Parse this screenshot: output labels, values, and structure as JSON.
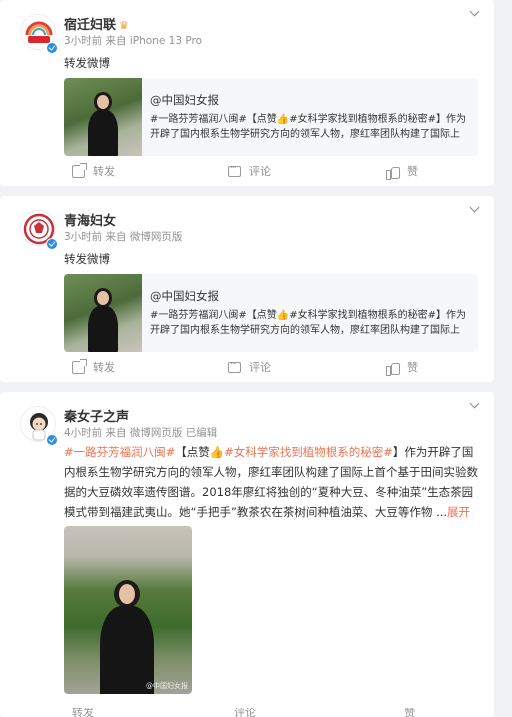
{
  "posts": [
    {
      "user": {
        "name": "宿迁妇联",
        "has_crown": true
      },
      "meta": "3小时前  来自 iPhone 13 Pro",
      "text": "转发微博",
      "quote": {
        "source": "@中国妇女报",
        "text": "#一路芬芳福润八闽#【点赞👍#女科学家找到植物根系的秘密#】作为开辟了国内根系生物学研究方向的领军人物，廖红率团队构建了国际上首…"
      },
      "actions": {
        "share": "转发",
        "comment": "评论",
        "like": "赞"
      }
    },
    {
      "user": {
        "name": "青海妇女",
        "has_crown": false
      },
      "meta": "3小时前  来自 微博网页版",
      "text": "转发微博",
      "quote": {
        "source": "@中国妇女报",
        "text": "#一路芬芳福润八闽#【点赞👍#女科学家找到植物根系的秘密#】作为开辟了国内根系生物学研究方向的领军人物，廖红率团队构建了国际上首…"
      },
      "actions": {
        "share": "转发",
        "comment": "评论",
        "like": "赞"
      }
    },
    {
      "user": {
        "name": "秦女子之声",
        "has_crown": false
      },
      "meta": "4小时前  来自 微博网页版  已编辑",
      "text_parts": {
        "tag1": "#一路芬芳福润八闽#",
        "p1": "【点赞👍",
        "tag2": "#女科学家找到植物根系的秘密#",
        "p2": "】作为开辟了国内根系生物学研究方向的领军人物，廖红率团队构建了国际上首个基于田间实验数据的大豆磷效率遗传图谱。2018年廖红将独创的“夏种大豆、冬种油菜”生态茶园模式带到福建武夷山。她“手把手”教茶农在茶树间种植油菜、大豆等作物 ...",
        "more": "展开"
      },
      "watermark": "@中国妇女报",
      "actions": {
        "share": "转发",
        "comment": "评论",
        "like": "赞"
      }
    }
  ],
  "colors": {
    "accent": "#eb7350",
    "verified": "#2b8de6",
    "background": "#f1f2f5"
  }
}
